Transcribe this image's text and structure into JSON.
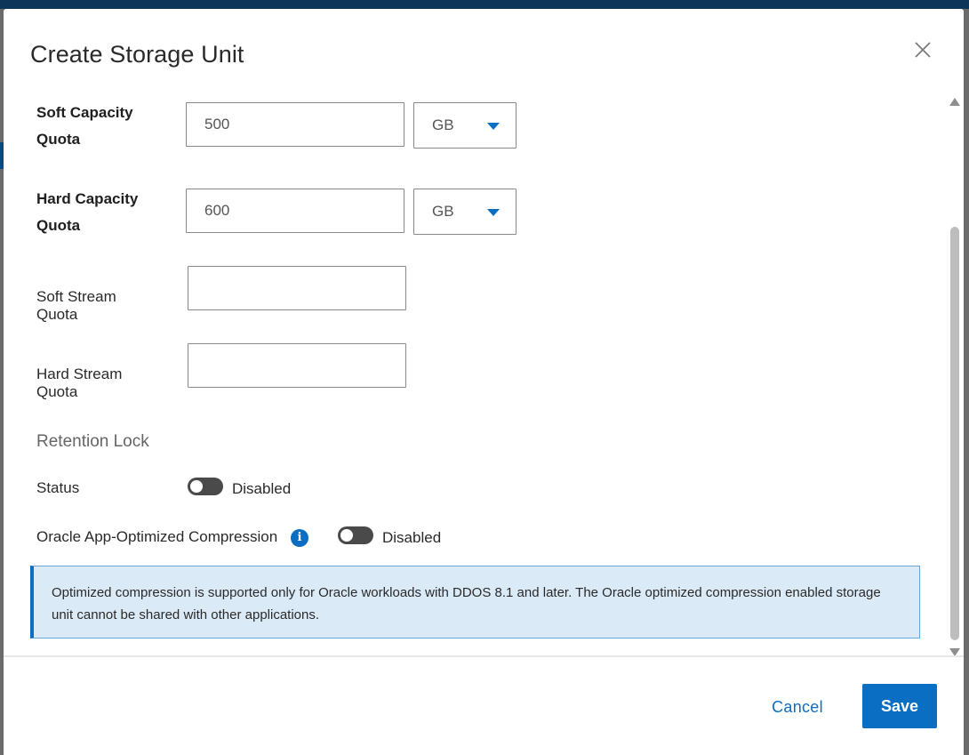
{
  "dialog": {
    "title": "Create Storage Unit"
  },
  "fields": {
    "soft_capacity": {
      "label_line1": "Soft Capacity",
      "label_line2": "Quota",
      "value": "500",
      "unit": "GB"
    },
    "hard_capacity": {
      "label_line1": "Hard Capacity",
      "label_line2": "Quota",
      "value": "600",
      "unit": "GB"
    },
    "soft_stream": {
      "label_line1": "Soft Stream",
      "label_line2": "Quota",
      "value": ""
    },
    "hard_stream": {
      "label_line1": "Hard Stream",
      "label_line2": "Quota",
      "value": ""
    }
  },
  "retention_lock": {
    "section_title": "Retention Lock",
    "status_label": "Status",
    "status_toggle_label": "Disabled",
    "status_enabled": false
  },
  "oracle": {
    "label": "Oracle App-Optimized Compression",
    "toggle_label": "Disabled",
    "enabled": false
  },
  "alert": {
    "text": "Optimized compression is supported only for Oracle workloads with DDOS 8.1 and later. The Oracle optimized compression enabled storage unit cannot be shared with other applications."
  },
  "footer": {
    "cancel_label": "Cancel",
    "save_label": "Save"
  },
  "colors": {
    "accent": "#0a6fc2",
    "alert_bg": "#dbeaf7",
    "toggle_off": "#4a4a4a"
  },
  "icons": {
    "close": "close-icon",
    "info": "info-icon",
    "dropdown": "chevron-down-icon"
  }
}
